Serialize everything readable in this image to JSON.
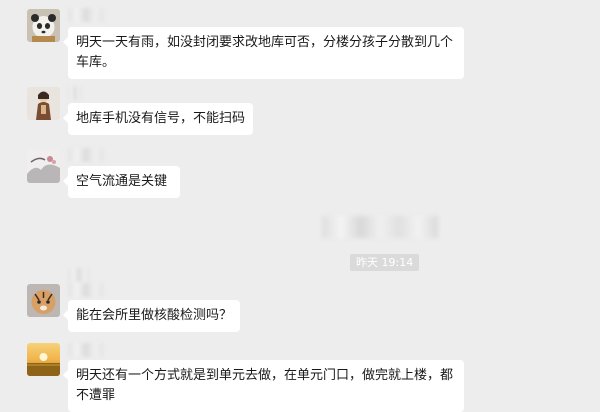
{
  "messages": [
    {
      "text": "明天一天有雨，如没封闭要求改地库可否，分楼分孩子分散到几个车库。",
      "avatar": "avatar-panda"
    },
    {
      "text": "地库手机没有信号，不能扫码",
      "avatar": "avatar-girl"
    },
    {
      "text": "空气流通是关键",
      "avatar": "avatar-ink-painting"
    },
    {
      "text": "能在会所里做核酸检测吗？",
      "avatar": "avatar-tiger"
    },
    {
      "text": "明天还有一个方式就是到单元去做，在单元门口，做完就上楼，都不遭罪",
      "avatar": "avatar-sunset-field"
    }
  ],
  "timestamp": "昨天 19:14"
}
